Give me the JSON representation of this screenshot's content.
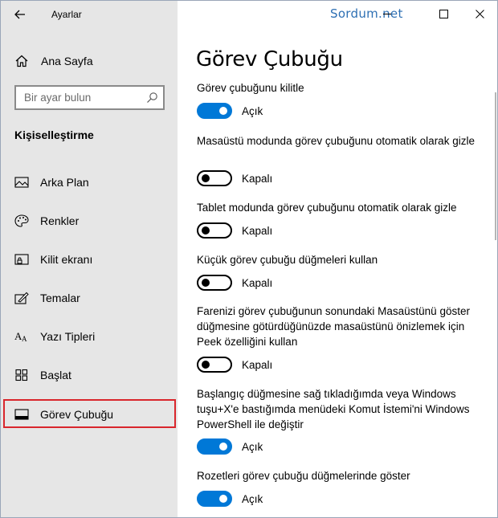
{
  "window": {
    "app_title": "Ayarlar",
    "watermark": "Sordum.net",
    "controls": [
      "minimize-icon",
      "maximize-icon",
      "close-icon"
    ]
  },
  "sidebar": {
    "home_label": "Ana Sayfa",
    "search_placeholder": "Bir ayar bulun",
    "section_title": "Kişiselleştirme",
    "items": [
      {
        "label": "Arka Plan",
        "icon": "picture-icon"
      },
      {
        "label": "Renkler",
        "icon": "palette-icon"
      },
      {
        "label": "Kilit ekranı",
        "icon": "lock-screen-icon"
      },
      {
        "label": "Temalar",
        "icon": "theme-icon"
      },
      {
        "label": "Yazı Tipleri",
        "icon": "fonts-icon"
      },
      {
        "label": "Başlat",
        "icon": "start-icon"
      },
      {
        "label": "Görev Çubuğu",
        "icon": "taskbar-icon",
        "selected": true
      }
    ]
  },
  "main": {
    "title": "Görev Çubuğu",
    "settings": [
      {
        "label": "Görev çubuğunu kilitle",
        "on": true,
        "state": "Açık"
      },
      {
        "label": "Masaüstü modunda görev çubuğunu otomatik olarak gizle",
        "on": false,
        "state": "Kapalı"
      },
      {
        "label": "Tablet modunda görev çubuğunu otomatik olarak gizle",
        "on": false,
        "state": "Kapalı"
      },
      {
        "label": "Küçük görev çubuğu düğmeleri kullan",
        "on": false,
        "state": "Kapalı"
      },
      {
        "label": "Farenizi görev çubuğunun sonundaki Masaüstünü göster düğmesine götürdüğünüzde masaüstünü önizlemek için Peek özelliğini kullan",
        "on": false,
        "state": "Kapalı"
      },
      {
        "label": "Başlangıç düğmesine sağ tıkladığımda veya Windows tuşu+X'e bastığımda menüdeki Komut İstemi'ni Windows PowerShell ile değiştir",
        "on": true,
        "state": "Açık"
      },
      {
        "label": "Rozetleri görev çubuğu düğmelerinde göster",
        "on": true,
        "state": "Açık"
      }
    ]
  },
  "colors": {
    "accent": "#0078d7",
    "sidebar_bg": "#e6e6e6",
    "highlight_border": "#d9262c",
    "watermark": "#2d6fb3"
  }
}
